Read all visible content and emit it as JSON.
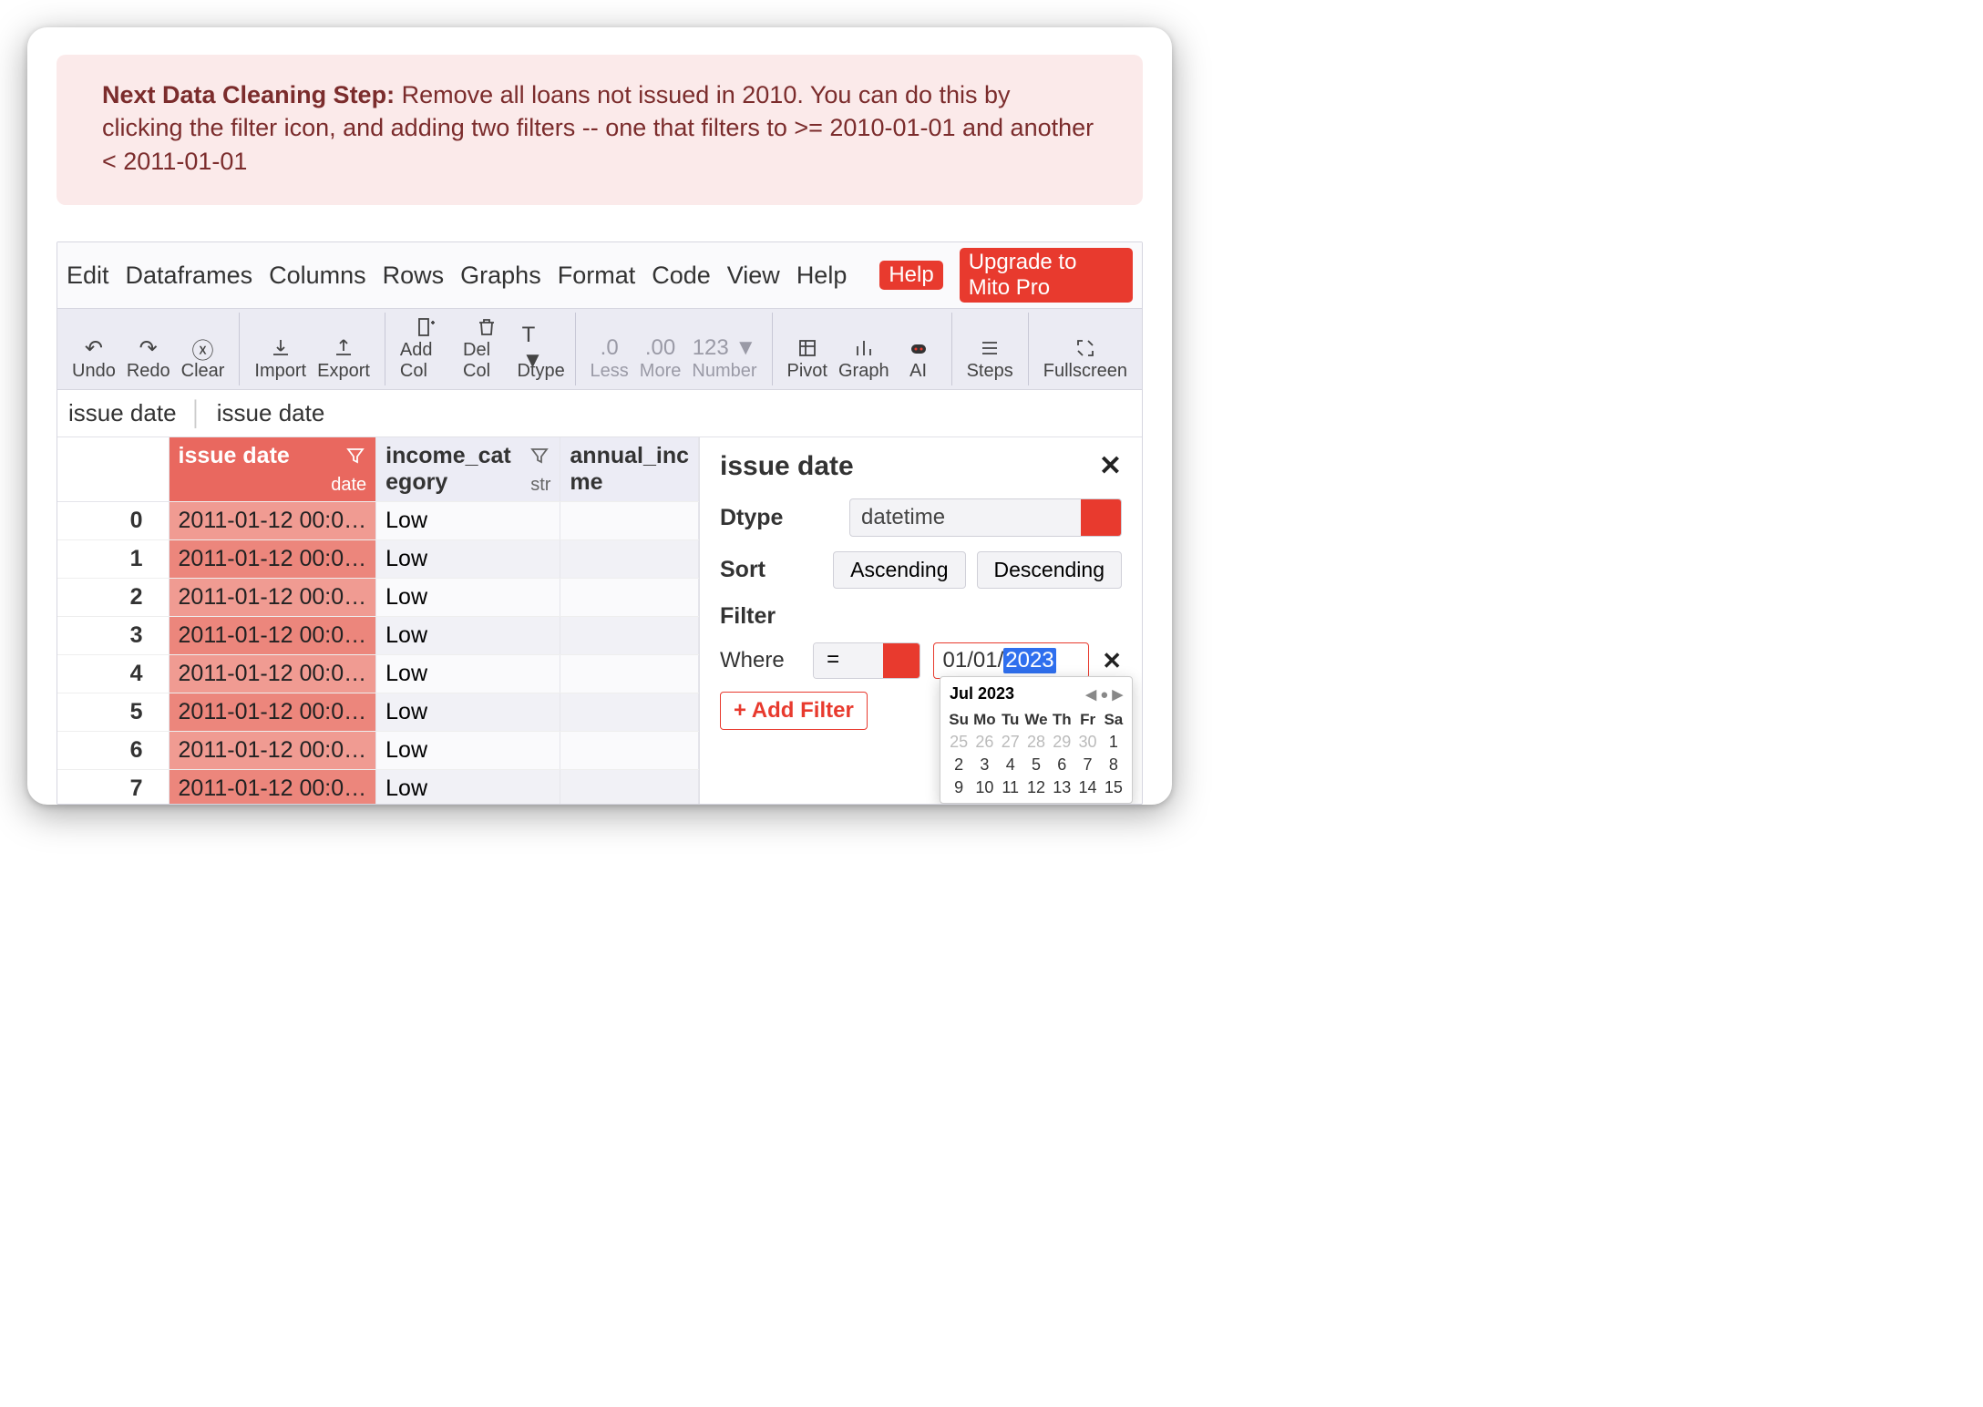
{
  "banner": {
    "strong": "Next Data Cleaning Step:",
    "text": " Remove all loans not issued in 2010. You can do this by clicking the filter icon, and adding two filters -- one that filters to >= 2010-01-01 and another < 2011-01-01"
  },
  "menu": {
    "items": [
      "Edit",
      "Dataframes",
      "Columns",
      "Rows",
      "Graphs",
      "Format",
      "Code",
      "View",
      "Help"
    ],
    "help": "Help",
    "upgrade": "Upgrade to Mito Pro"
  },
  "toolbar": {
    "undo": "Undo",
    "redo": "Redo",
    "clear": "Clear",
    "import": "Import",
    "export": "Export",
    "addcol": "Add Col",
    "delcol": "Del Col",
    "dtype": "Dtype",
    "dtype_val": "T ▼",
    "less": "Less",
    "less_val": ".0",
    "more": "More",
    "more_val": ".00",
    "number": "Number",
    "number_val": "123 ▼",
    "pivot": "Pivot",
    "graph": "Graph",
    "ai": "AI",
    "steps": "Steps",
    "fullscreen": "Fullscreen"
  },
  "formula": {
    "left": "issue date",
    "right": "issue date"
  },
  "columns": [
    {
      "name": "issue date",
      "dtype": "date",
      "selected": true
    },
    {
      "name": "income_category",
      "dtype": "str",
      "selected": false
    },
    {
      "name": "annual_income",
      "dtype": "",
      "selected": false
    }
  ],
  "column_display": {
    "c1": "issue date",
    "c1_type": "date",
    "c2": "income_cat\negory",
    "c2_type": "str",
    "c3": "annual_inc\nme"
  },
  "rows": [
    {
      "idx": "0",
      "issue_date": "2011-01-12 00:0…",
      "income_cat": "Low",
      "annual_inc": ""
    },
    {
      "idx": "1",
      "issue_date": "2011-01-12 00:0…",
      "income_cat": "Low",
      "annual_inc": ""
    },
    {
      "idx": "2",
      "issue_date": "2011-01-12 00:0…",
      "income_cat": "Low",
      "annual_inc": ""
    },
    {
      "idx": "3",
      "issue_date": "2011-01-12 00:0…",
      "income_cat": "Low",
      "annual_inc": ""
    },
    {
      "idx": "4",
      "issue_date": "2011-01-12 00:0…",
      "income_cat": "Low",
      "annual_inc": ""
    },
    {
      "idx": "5",
      "issue_date": "2011-01-12 00:0…",
      "income_cat": "Low",
      "annual_inc": ""
    },
    {
      "idx": "6",
      "issue_date": "2011-01-12 00:0…",
      "income_cat": "Low",
      "annual_inc": ""
    },
    {
      "idx": "7",
      "issue_date": "2011-01-12 00:0…",
      "income_cat": "Low",
      "annual_inc": ""
    }
  ],
  "panel": {
    "title": "issue date",
    "dtype_label": "Dtype",
    "dtype_value": "datetime",
    "sort_label": "Sort",
    "asc": "Ascending",
    "desc": "Descending",
    "filter_label": "Filter",
    "where": "Where",
    "op": "=",
    "date_prefix": "01/01/",
    "date_year": "2023",
    "add_filter": "+ Add Filter"
  },
  "datepicker": {
    "month": "Jul 2023",
    "dows": [
      "Su",
      "Mo",
      "Tu",
      "We",
      "Th",
      "Fr",
      "Sa"
    ],
    "prev_days": [
      "25",
      "26",
      "27",
      "28",
      "29",
      "30"
    ],
    "days_row1": [
      "1"
    ],
    "days_row2": [
      "2",
      "3",
      "4",
      "5",
      "6",
      "7",
      "8"
    ],
    "days_row3": [
      "9",
      "10",
      "11",
      "12",
      "13",
      "14",
      "15"
    ]
  }
}
